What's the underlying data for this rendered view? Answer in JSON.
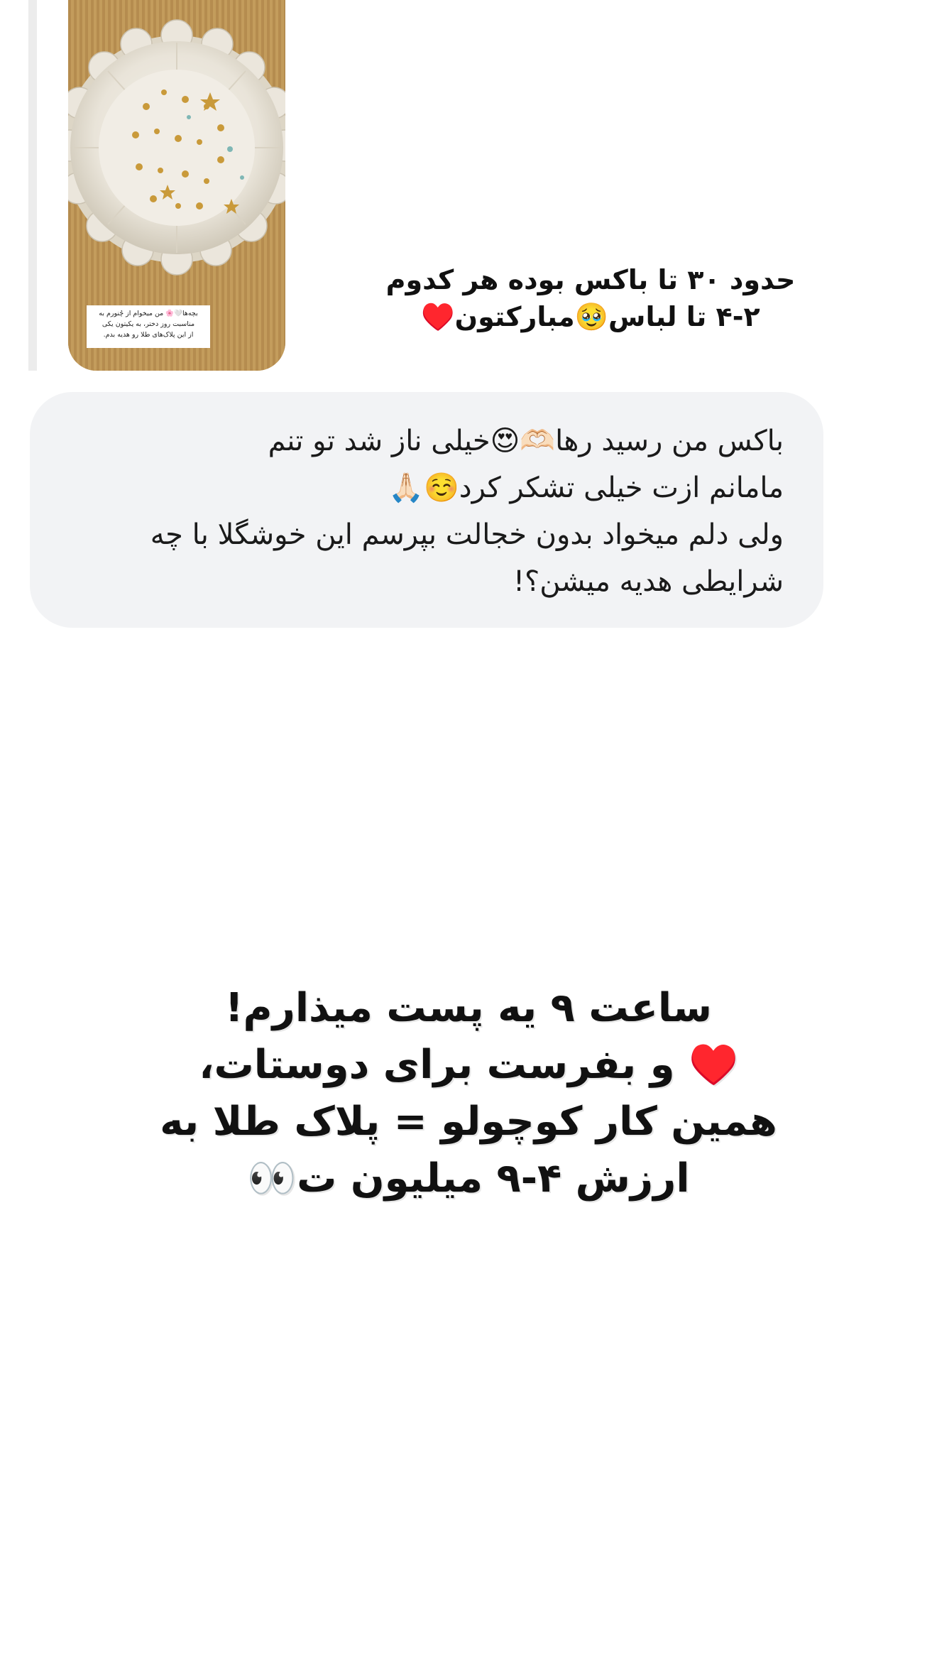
{
  "story_reply": {
    "thumbnail": {
      "icon": "gold-charms-plate-photo",
      "caption": "بچه‌ها🤍🌸 من میخوام از چُنورم به\nمناسبت روز دختر، به یکیتون یکی\nاز این پلاک‌های طلا رو هدیه بدم."
    },
    "overlay_text": "حدود ۳۰ تا باکس بوده هر کدوم\n۴-۲ تا لباس🥹مبارکتون♥️"
  },
  "reply_message": {
    "text": "باکس من رسید رها🫶🏻😍خیلی ناز شد تو تنم\nمامانم ازت خیلی تشکر کرد☺️🙏🏻\nولی دلم میخواد بدون خجالت بپرسم این خوشگلا با چه\nشرایطی هدیه میشن؟!"
  },
  "announcement": {
    "text": "ساعت ۹ یه پست میذارم!\n♥️ و بفرست برای دوستات،\nهمین کار کوچولو = پلاک طلا به\nارزش ۴-۹ میلیون ت👀"
  },
  "colors": {
    "bubble_bg": "#f2f3f5",
    "quote_bar": "#ececec",
    "text": "#111111"
  }
}
